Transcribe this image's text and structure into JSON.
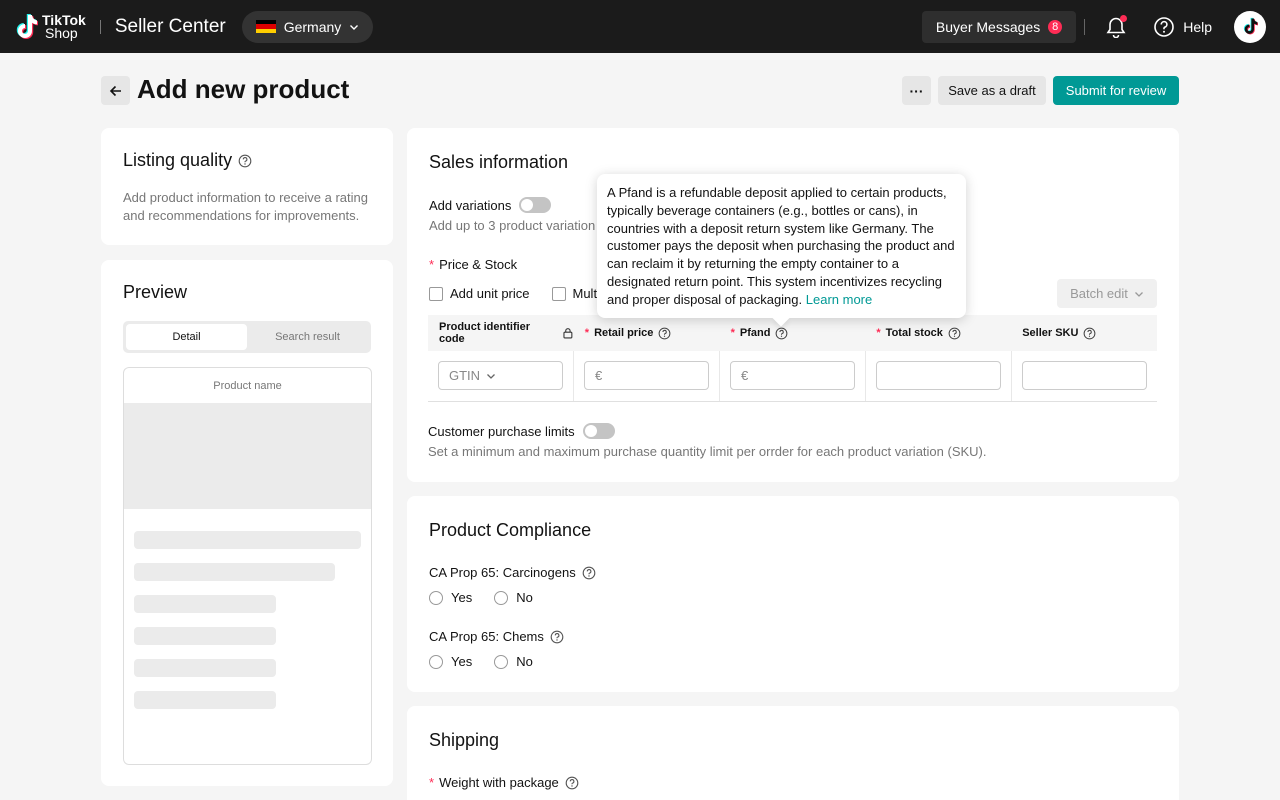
{
  "topbar": {
    "brand_line1": "TikTok",
    "brand_line2": "Shop",
    "app_title": "Seller Center",
    "region": "Germany",
    "buyer_messages_label": "Buyer Messages",
    "buyer_messages_count": "8",
    "help_label": "Help",
    "colors": {
      "background": "#1b1b1b",
      "badge": "#fe2c55"
    }
  },
  "header": {
    "title": "Add new product",
    "more_label": "···",
    "draft_label": "Save as a draft",
    "submit_label": "Submit for review",
    "accent": "#009995"
  },
  "listing_quality": {
    "title": "Listing quality",
    "description": "Add product information to receive a rating and recommendations for improvements."
  },
  "preview": {
    "title": "Preview",
    "tabs": [
      "Detail",
      "Search result"
    ],
    "active_tab": "Detail",
    "product_name_placeholder": "Product name"
  },
  "sales": {
    "title": "Sales information",
    "variations_label": "Add variations",
    "variations_hint": "Add up to 3 product variation",
    "price_stock_label": "Price & Stock",
    "add_unit_price_label": "Add unit price",
    "multi_label": "Mult",
    "batch_edit_label": "Batch edit",
    "columns": [
      {
        "label": "Product identifier code",
        "required": false,
        "icon": "lock-icon"
      },
      {
        "label": "Retail price",
        "required": true,
        "icon": "help-circle-icon"
      },
      {
        "label": "Pfand",
        "required": true,
        "icon": "help-circle-icon"
      },
      {
        "label": "Total stock",
        "required": true,
        "icon": "help-circle-icon"
      },
      {
        "label": "Seller SKU",
        "required": false,
        "icon": "help-circle-icon"
      }
    ],
    "gtin_value": "GTIN",
    "currency_prefix": "€",
    "purchase_limits_label": "Customer purchase limits",
    "purchase_limits_hint": "Set a minimum and maximum purchase quantity limit per orrder for each product variation (SKU)."
  },
  "tooltip": {
    "text": "A Pfand is a refundable deposit applied to certain products, typically beverage containers (e.g., bottles or cans), in countries with a deposit return system like Germany. The customer pays the deposit when purchasing the product and can reclaim it by returning the empty container to a designated return point. This system incentivizes recycling and proper disposal of packaging.",
    "link_label": "Learn more"
  },
  "compliance": {
    "title": "Product Compliance",
    "questions": [
      {
        "label": "CA Prop 65: Carcinogens",
        "options": [
          "Yes",
          "No"
        ]
      },
      {
        "label": "CA Prop 65: Chems",
        "options": [
          "Yes",
          "No"
        ]
      }
    ]
  },
  "shipping": {
    "title": "Shipping",
    "weight_label": "Weight with package"
  }
}
